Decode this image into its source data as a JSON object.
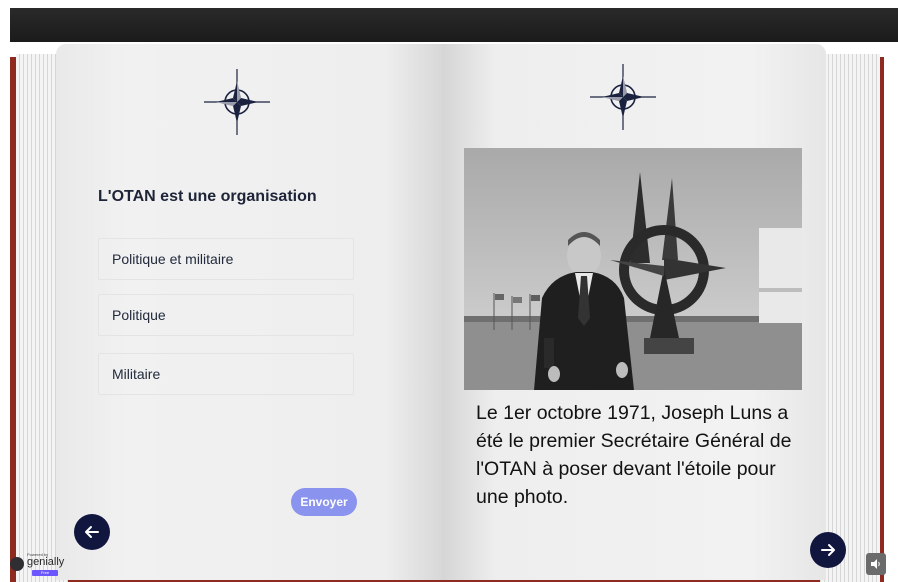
{
  "quiz": {
    "question": "L'OTAN est une organisation",
    "options": [
      {
        "label": "Politique et militaire"
      },
      {
        "label": "Politique"
      },
      {
        "label": "Militaire"
      }
    ],
    "submit_label": "Envoyer"
  },
  "info": {
    "caption": "Le 1er octobre 1971, Joseph Luns a été le premier Secrétaire Général de l'OTAN à poser devant l'étoile pour une photo."
  },
  "branding": {
    "powered_by": "Powered by",
    "name": "genially",
    "badge": "Free"
  },
  "icons": {
    "compass": "nato-compass-icon",
    "prev": "arrow-left-icon",
    "next": "arrow-right-icon",
    "sound": "speaker-icon"
  },
  "colors": {
    "navy": "#11163f",
    "button": "#8a93ee",
    "cover": "#8e2a1f"
  }
}
